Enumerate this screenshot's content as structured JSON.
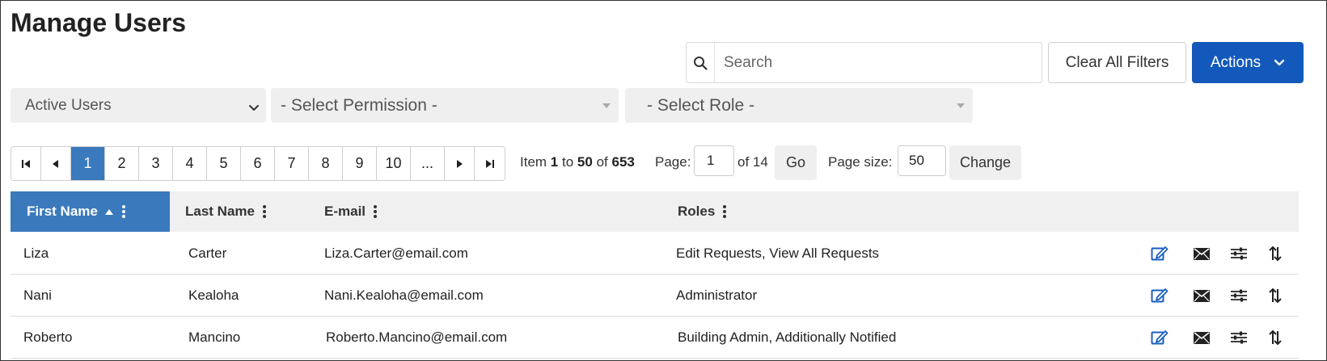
{
  "page_title": "Manage Users",
  "search": {
    "placeholder": "Search",
    "value": ""
  },
  "buttons": {
    "clear_filters": "Clear All Filters",
    "actions": "Actions"
  },
  "filters": {
    "status": "Active Users",
    "permission": "- Select Permission -",
    "role": "- Select Role -"
  },
  "pagination": {
    "pages": [
      "1",
      "2",
      "3",
      "4",
      "5",
      "6",
      "7",
      "8",
      "9",
      "10",
      "..."
    ],
    "current_page": "1",
    "item_prefix": "Item",
    "item_from": "1",
    "item_to_label": "to",
    "item_to": "50",
    "item_of_label": "of",
    "item_total": "653",
    "page_label": "Page:",
    "page_value": "1",
    "of_pages": "of 14",
    "go": "Go",
    "page_size_label": "Page size:",
    "page_size": "50",
    "change": "Change"
  },
  "columns": {
    "first_name": "First Name",
    "last_name": "Last Name",
    "email": "E-mail",
    "roles": "Roles"
  },
  "rows": [
    {
      "first": "Liza",
      "last": "Carter",
      "email": "Liza.Carter@email.com",
      "roles": "Edit Requests, View All Requests"
    },
    {
      "first": "Nani",
      "last": "Kealoha",
      "email": "Nani.Kealoha@email.com",
      "roles": "Administrator"
    },
    {
      "first": "Roberto",
      "last": "Mancino",
      "email": "Roberto.Mancino@email.com",
      "roles": "Building Admin, Additionally Notified"
    }
  ],
  "row_action_icons": [
    "edit-icon",
    "mail-icon",
    "settings-sliders-icon",
    "reorder-icon"
  ],
  "colors": {
    "primary": "#1359bb",
    "sorted_header": "#3a7abc",
    "active_page": "#3a7abc"
  }
}
